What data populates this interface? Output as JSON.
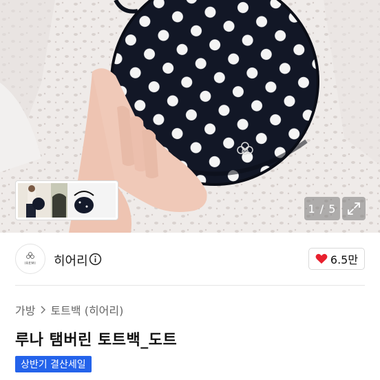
{
  "gallery": {
    "counter": "1 / 5",
    "current": 1,
    "total": 5
  },
  "seller": {
    "avatar_text": "IREMI",
    "name": "히어리"
  },
  "likes": {
    "count": "6.5만"
  },
  "breadcrumb": {
    "category": "가방",
    "subcategory": "토트백 (히어리)"
  },
  "product": {
    "title": "루나 탬버린 토트백_도트",
    "badge": "상반기 결산세일"
  },
  "colors": {
    "accent_blue": "#2463eb",
    "heart_red": "#e8202e",
    "bag_navy": "#141a2b"
  }
}
